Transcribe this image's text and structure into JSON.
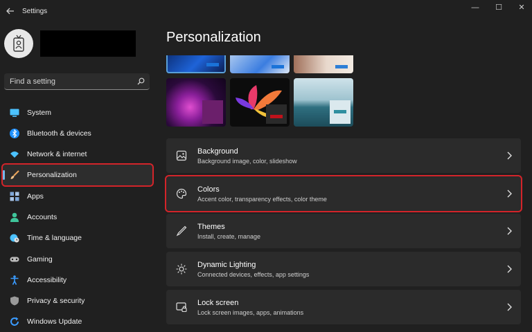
{
  "window": {
    "title": "Settings",
    "controls": {
      "minimize": "—",
      "maximize": "☐",
      "close": "✕"
    }
  },
  "search": {
    "placeholder": "Find a setting"
  },
  "sidebar": {
    "items": [
      {
        "label": "System",
        "icon": "monitor-icon",
        "color": "#4cc2ff"
      },
      {
        "label": "Bluetooth & devices",
        "icon": "bluetooth-icon",
        "color": "#1e90ff"
      },
      {
        "label": "Network & internet",
        "icon": "wifi-icon",
        "color": "#4cc2ff"
      },
      {
        "label": "Personalization",
        "icon": "paintbrush-icon",
        "color": "#e8a35a",
        "selected": true
      },
      {
        "label": "Apps",
        "icon": "apps-icon",
        "color": "#7fa7d9"
      },
      {
        "label": "Accounts",
        "icon": "person-icon",
        "color": "#3fc59a"
      },
      {
        "label": "Time & language",
        "icon": "globe-clock-icon",
        "color": "#4cc2ff"
      },
      {
        "label": "Gaming",
        "icon": "gamepad-icon",
        "color": "#bdbdbd"
      },
      {
        "label": "Accessibility",
        "icon": "accessibility-icon",
        "color": "#3a9bff"
      },
      {
        "label": "Privacy & security",
        "icon": "shield-icon",
        "color": "#9a9a9a"
      },
      {
        "label": "Windows Update",
        "icon": "update-icon",
        "color": "#3a9bff"
      }
    ]
  },
  "main": {
    "title": "Personalization",
    "themes": [
      {
        "name": "windows-bloom-dark",
        "swatch": "#1a73d9"
      },
      {
        "name": "windows-bloom-light",
        "swatch": "#1a73d9"
      },
      {
        "name": "captured-motion",
        "swatch": "#2e7fd6"
      },
      {
        "name": "glow",
        "swatch": "#6b1f6b"
      },
      {
        "name": "captured-motion-flower",
        "swatch": "#c0121b"
      },
      {
        "name": "flow",
        "swatch": "#2f8fa0"
      }
    ],
    "cards": [
      {
        "title": "Background",
        "subtitle": "Background image, color, slideshow",
        "icon": "image-icon"
      },
      {
        "title": "Colors",
        "subtitle": "Accent color, transparency effects, color theme",
        "icon": "palette-icon",
        "highlighted": true
      },
      {
        "title": "Themes",
        "subtitle": "Install, create, manage",
        "icon": "pen-icon"
      },
      {
        "title": "Dynamic Lighting",
        "subtitle": "Connected devices, effects, app settings",
        "icon": "lighting-icon"
      },
      {
        "title": "Lock screen",
        "subtitle": "Lock screen images, apps, animations",
        "icon": "lock-screen-icon"
      }
    ]
  },
  "colors": {
    "highlight": "#d4242a",
    "accent": "#76b9ed",
    "background": "#202020",
    "card": "#2b2b2b"
  }
}
